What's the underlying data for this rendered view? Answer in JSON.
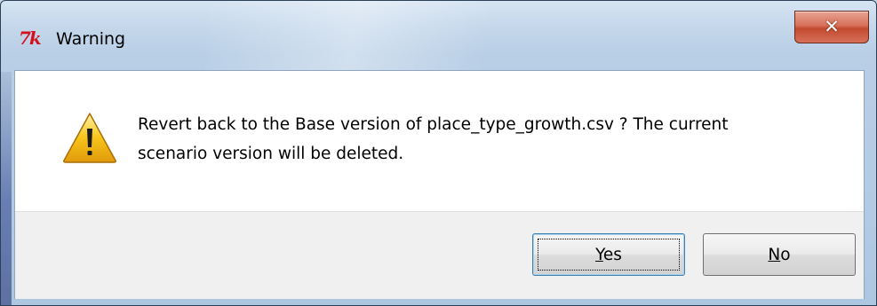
{
  "window": {
    "title": "Warning",
    "app_icon_text": "7k",
    "close_glyph": "✕"
  },
  "dialog": {
    "icon": "warning-icon",
    "message_line1": "Revert back to the Base version of place_type_growth.csv ? The current",
    "message_line2": "scenario version will be deleted."
  },
  "buttons": {
    "yes": {
      "mnemonic": "Y",
      "rest": "es"
    },
    "no": {
      "mnemonic": "N",
      "rest": "o"
    }
  },
  "colors": {
    "warning_yellow": "#f6c419",
    "close_red": "#c24a30",
    "focus_blue": "#3c7fb1"
  }
}
